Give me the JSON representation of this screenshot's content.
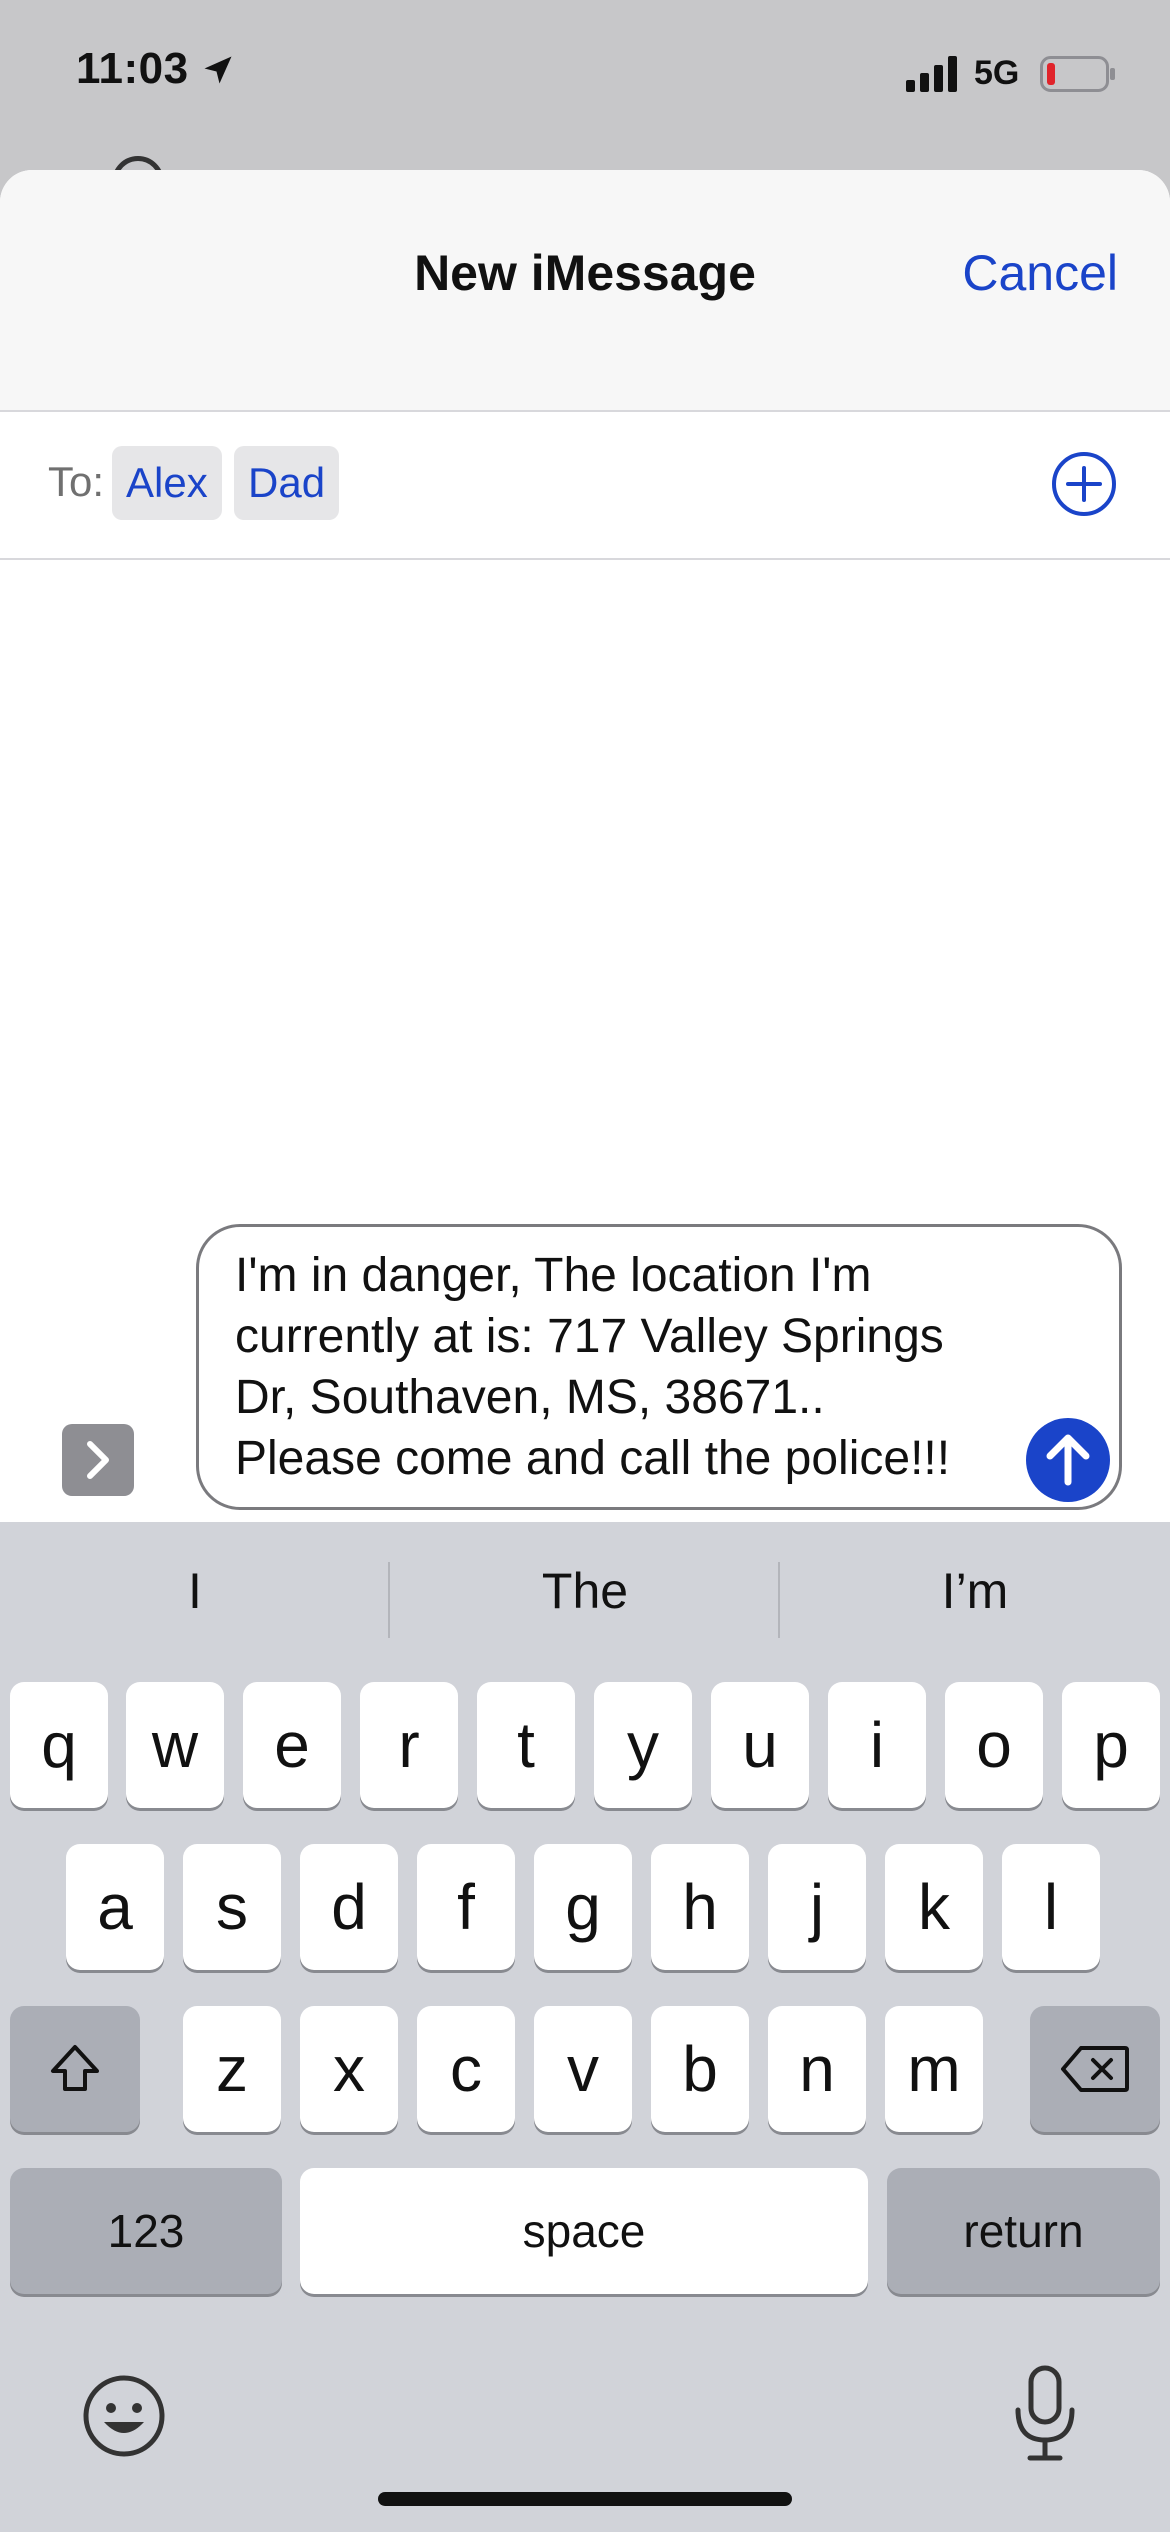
{
  "status_bar": {
    "time": "11:03",
    "network": "5G",
    "battery_color": "#e0242b"
  },
  "sheet": {
    "title": "New iMessage",
    "cancel_label": "Cancel"
  },
  "recipients": {
    "to_label": "To:",
    "chips": [
      "Alex",
      "Dad"
    ]
  },
  "compose": {
    "message": "I'm in danger, The location I'm\ncurrently at is: 717 Valley Springs\nDr, Southaven, MS, 38671..\nPlease come and call the police!!!"
  },
  "keyboard": {
    "suggestions": [
      "I",
      "The",
      "I’m"
    ],
    "row1": [
      "q",
      "w",
      "e",
      "r",
      "t",
      "y",
      "u",
      "i",
      "o",
      "p"
    ],
    "row2": [
      "a",
      "s",
      "d",
      "f",
      "g",
      "h",
      "j",
      "k",
      "l"
    ],
    "row3": [
      "z",
      "x",
      "c",
      "v",
      "b",
      "n",
      "m"
    ],
    "numbers_label": "123",
    "space_label": "space",
    "return_label": "return"
  },
  "colors": {
    "accent": "#1a44c9",
    "keyboard_bg": "#d1d3d9"
  }
}
